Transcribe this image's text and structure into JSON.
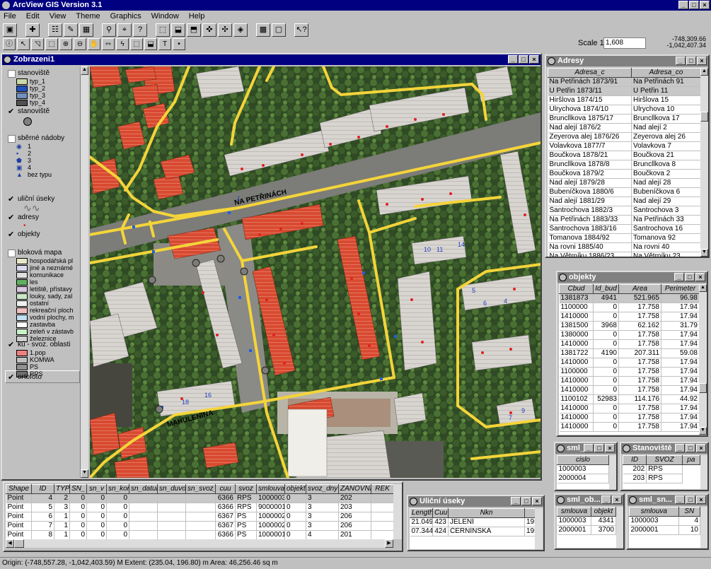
{
  "app_title": "ArcView GIS Version 3.1",
  "menu": [
    "File",
    "Edit",
    "View",
    "Theme",
    "Graphics",
    "Window",
    "Help"
  ],
  "scale_label": "Scale 1:",
  "scale_value": "1,608",
  "coords": [
    "-748,309.66",
    "-1,042,407.34"
  ],
  "view_title": "Zobrazeni1",
  "map_labels": {
    "street1": "NA PETŘINÁCH",
    "street2": "MAHULENINA",
    "numbers": [
      "10",
      "11",
      "14",
      "16",
      "18",
      "5",
      "6",
      "4",
      "9",
      "7",
      "1"
    ]
  },
  "legend": {
    "groups": [
      {
        "name": "stanoviště",
        "items": [
          "typ_1",
          "typ_2",
          "typ_3",
          "typ_4"
        ],
        "checked": false
      },
      {
        "name": "stanoviště",
        "items": [],
        "checked": true
      },
      {
        "name": "sběrné nádoby",
        "items": [
          "1",
          "2",
          "3",
          "4",
          "bez typu"
        ],
        "checked": false
      },
      {
        "name": "uliční úseky",
        "items": [],
        "checked": true
      },
      {
        "name": "adresy",
        "items": [],
        "checked": true
      },
      {
        "name": "objekty",
        "items": [],
        "checked": true
      },
      {
        "name": "bloková mapa",
        "items": [
          "hospodářská pl",
          "jiné a neznámé",
          "komunikace",
          "les",
          "letiště, přístavy",
          "louky, sady, zal",
          "ostatní",
          "rekreační ploch",
          "vodní plochy, m",
          "zastavba",
          "zeleň v zástavb",
          "železnice"
        ],
        "checked": false
      },
      {
        "name": "kú - svoz. oblasti",
        "items": [
          "1.pop",
          "KOMWA",
          "PS",
          "RPS"
        ],
        "checked": true
      },
      {
        "name": "ortofoto",
        "items": [],
        "checked": true
      }
    ]
  },
  "colors": {
    "legend_swatches": [
      "#e8e8c8",
      "#d8d8f0",
      "#e0e0e0",
      "#60b060",
      "#d8c8e0",
      "#c8e8c8",
      "#f0f0f0",
      "#f0c0c0",
      "#c0e0f0",
      "#ffffff",
      "#c8f0c8",
      "#d0d0d0"
    ],
    "svoz_swatches": [
      "#f08080",
      "#c0c0c0",
      "#909090",
      "#707070"
    ]
  },
  "adresy": {
    "title": "Adresy",
    "columns": [
      "Adresa_c",
      "Adresa_co"
    ],
    "rows": [
      [
        "Na Petřinách 1873/91",
        "Na Petřinách 91"
      ],
      [
        "U Petřin 1873/11",
        "U Petřin 11"
      ],
      [
        "Hiršlova 1874/15",
        "Hiršlova 15"
      ],
      [
        "Ulrychova 1874/10",
        "Ulrychova 10"
      ],
      [
        "Bruncllkova 1875/17",
        "Bruncllkova 17"
      ],
      [
        "Nad alejí 1876/2",
        "Nad alejí 2"
      ],
      [
        "Zeyerova alej 1876/26",
        "Zeyerova alej 26"
      ],
      [
        "Volavkova 1877/7",
        "Volavkova 7"
      ],
      [
        "Boučkova 1878/21",
        "Boučkova 21"
      ],
      [
        "Bruncllkova 1878/8",
        "Bruncllkova 8"
      ],
      [
        "Boučkova 1879/2",
        "Boučkova 2"
      ],
      [
        "Nad alejí 1879/28",
        "Nad alejí 28"
      ],
      [
        "Bubeníčkova 1880/6",
        "Bubeníčkova 6"
      ],
      [
        "Nad alejí 1881/29",
        "Nad alejí 29"
      ],
      [
        "Šantrochova 1882/3",
        "Šantrochova 3"
      ],
      [
        "Na Petřinách 1883/33",
        "Na Petřinách 33"
      ],
      [
        "Šantrochova 1883/16",
        "Šantrochova 16"
      ],
      [
        "Tomanova 1884/92",
        "Tomanova 92"
      ],
      [
        "Na rovni 1885/40",
        "Na rovni 40"
      ],
      [
        "Na Větrníku 1886/23",
        "Na Větrníku 23"
      ]
    ]
  },
  "objekty": {
    "title": "objekty",
    "columns": [
      "Cbud",
      "Id_bud",
      "Area",
      "Perimeter"
    ],
    "rows": [
      [
        "1381873",
        "4941",
        "521.965",
        "96.98"
      ],
      [
        "1100000",
        "0",
        "17.758",
        "17.94"
      ],
      [
        "1410000",
        "0",
        "17.758",
        "17.94"
      ],
      [
        "1381500",
        "3968",
        "62.162",
        "31.79"
      ],
      [
        "1380000",
        "0",
        "17.758",
        "17.94"
      ],
      [
        "1410000",
        "0",
        "17.758",
        "17.94"
      ],
      [
        "1381722",
        "4190",
        "207.311",
        "59.08"
      ],
      [
        "1410000",
        "0",
        "17.758",
        "17.94"
      ],
      [
        "1100000",
        "0",
        "17.758",
        "17.94"
      ],
      [
        "1410000",
        "0",
        "17.758",
        "17.94"
      ],
      [
        "1410000",
        "0",
        "17.758",
        "17.94"
      ],
      [
        "1100102",
        "52983",
        "114.176",
        "44.92"
      ],
      [
        "1410000",
        "0",
        "17.758",
        "17.94"
      ],
      [
        "1410000",
        "0",
        "17.758",
        "17.94"
      ],
      [
        "1410000",
        "0",
        "17.758",
        "17.94"
      ]
    ]
  },
  "attr": {
    "columns": [
      "Shape",
      "ID",
      "TYP",
      "SN_",
      "sn_v",
      "sn_kon",
      "sn_datum",
      "sn_duvod",
      "sn_svoz_",
      "cuu",
      "svoz",
      "smlouva",
      "objekt",
      "svoz_dny",
      "ZANOVNI",
      "REK"
    ],
    "rows": [
      [
        "Point",
        "4",
        "2",
        "0",
        "0",
        "0",
        "",
        "",
        "",
        "6366",
        "RPS",
        "1000003",
        "0",
        "3",
        "202",
        ""
      ],
      [
        "Point",
        "5",
        "3",
        "0",
        "0",
        "0",
        "",
        "",
        "",
        "6366",
        "RPS",
        "9000001",
        "0",
        "3",
        "203",
        ""
      ],
      [
        "Point",
        "6",
        "1",
        "0",
        "0",
        "0",
        "",
        "",
        "",
        "6367",
        "PS",
        "1000002",
        "0",
        "3",
        "206",
        ""
      ],
      [
        "Point",
        "7",
        "1",
        "0",
        "0",
        "0",
        "",
        "",
        "",
        "6367",
        "PS",
        "1000002",
        "0",
        "3",
        "206",
        ""
      ],
      [
        "Point",
        "8",
        "1",
        "0",
        "0",
        "0",
        "",
        "",
        "",
        "6366",
        "PS",
        "1000001",
        "0",
        "4",
        "201",
        ""
      ]
    ]
  },
  "ulicni": {
    "title": "Uliční úseky",
    "columns": [
      "Length",
      "Cuu",
      "Nkn",
      ""
    ],
    "rows": [
      [
        "21.049",
        "423",
        "JELENÍ",
        "195"
      ],
      [
        "07.344",
        "424",
        "ČERNÍNSKÁ",
        "195"
      ]
    ]
  },
  "sml_o": {
    "title": "sml_o...",
    "columns": [
      "cislo"
    ],
    "rows": [
      [
        "1000003"
      ],
      [
        "2000004"
      ]
    ]
  },
  "stanoviste": {
    "title": "Stanoviště",
    "columns": [
      "ID",
      "SVOZ",
      "pa"
    ],
    "rows": [
      [
        "202",
        "RPS"
      ],
      [
        "203",
        "RPS"
      ]
    ]
  },
  "sml_ob": {
    "title": "sml_ob...",
    "columns": [
      "smlouva",
      "objekt"
    ],
    "rows": [
      [
        "1000003",
        "4341"
      ],
      [
        "2000001",
        "3700"
      ]
    ]
  },
  "sml_sn": {
    "title": "sml_sn...",
    "columns": [
      "smlouva",
      "SN"
    ],
    "rows": [
      [
        "1000003",
        "4"
      ],
      [
        "2000001",
        "10"
      ]
    ]
  },
  "status": "Origin: (-748,557.28, -1,042,403.59) M  Extent: (235.04, 196.80) m  Area: 46,256.46 sq m"
}
